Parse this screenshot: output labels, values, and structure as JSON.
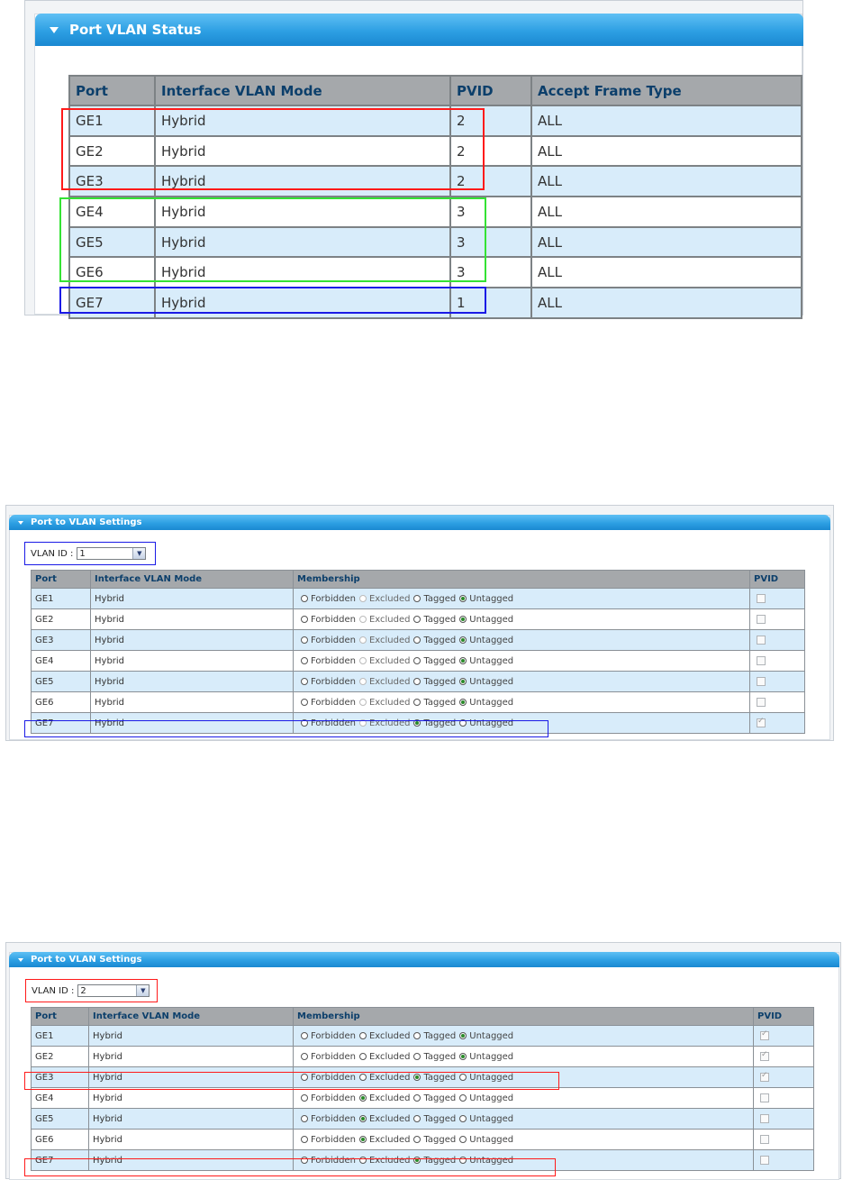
{
  "status_panel": {
    "title": "Port VLAN Status",
    "columns": [
      "Port",
      "Interface VLAN Mode",
      "PVID",
      "Accept Frame Type"
    ],
    "rows": [
      {
        "port": "GE1",
        "mode": "Hybrid",
        "pvid": "2",
        "accept": "ALL"
      },
      {
        "port": "GE2",
        "mode": "Hybrid",
        "pvid": "2",
        "accept": "ALL"
      },
      {
        "port": "GE3",
        "mode": "Hybrid",
        "pvid": "2",
        "accept": "ALL"
      },
      {
        "port": "GE4",
        "mode": "Hybrid",
        "pvid": "3",
        "accept": "ALL"
      },
      {
        "port": "GE5",
        "mode": "Hybrid",
        "pvid": "3",
        "accept": "ALL"
      },
      {
        "port": "GE6",
        "mode": "Hybrid",
        "pvid": "3",
        "accept": "ALL"
      },
      {
        "port": "GE7",
        "mode": "Hybrid",
        "pvid": "1",
        "accept": "ALL"
      }
    ]
  },
  "membership_options": [
    "Forbidden",
    "Excluded",
    "Tagged",
    "Untagged"
  ],
  "settings_panel_1": {
    "title": "Port to VLAN Settings",
    "vlan_id_label": "VLAN ID :",
    "vlan_id_value": "1",
    "columns": [
      "Port",
      "Interface VLAN Mode",
      "Membership",
      "PVID"
    ],
    "rows": [
      {
        "port": "GE1",
        "mode": "Hybrid",
        "membership": "Untagged",
        "pvid_checked": false
      },
      {
        "port": "GE2",
        "mode": "Hybrid",
        "membership": "Untagged",
        "pvid_checked": false
      },
      {
        "port": "GE3",
        "mode": "Hybrid",
        "membership": "Untagged",
        "pvid_checked": false
      },
      {
        "port": "GE4",
        "mode": "Hybrid",
        "membership": "Untagged",
        "pvid_checked": false
      },
      {
        "port": "GE5",
        "mode": "Hybrid",
        "membership": "Untagged",
        "pvid_checked": false
      },
      {
        "port": "GE6",
        "mode": "Hybrid",
        "membership": "Untagged",
        "pvid_checked": false
      },
      {
        "port": "GE7",
        "mode": "Hybrid",
        "membership": "Tagged",
        "pvid_checked": true
      }
    ]
  },
  "settings_panel_2": {
    "title": "Port to VLAN Settings",
    "vlan_id_label": "VLAN ID :",
    "vlan_id_value": "2",
    "columns": [
      "Port",
      "Interface VLAN Mode",
      "Membership",
      "PVID"
    ],
    "rows": [
      {
        "port": "GE1",
        "mode": "Hybrid",
        "membership": "Untagged",
        "pvid_checked": true
      },
      {
        "port": "GE2",
        "mode": "Hybrid",
        "membership": "Untagged",
        "pvid_checked": true
      },
      {
        "port": "GE3",
        "mode": "Hybrid",
        "membership": "Tagged",
        "pvid_checked": true
      },
      {
        "port": "GE4",
        "mode": "Hybrid",
        "membership": "Excluded",
        "pvid_checked": false
      },
      {
        "port": "GE5",
        "mode": "Hybrid",
        "membership": "Excluded",
        "pvid_checked": false
      },
      {
        "port": "GE6",
        "mode": "Hybrid",
        "membership": "Excluded",
        "pvid_checked": false
      },
      {
        "port": "GE7",
        "mode": "Hybrid",
        "membership": "Tagged",
        "pvid_checked": false
      }
    ]
  },
  "colors": {
    "title_bar": "#2d9fe3",
    "header_bg": "#a5a8ab",
    "header_text": "#0c3f6b",
    "row_alt": "#d8ecfa",
    "highlight_red": "#ff1a1a",
    "highlight_green": "#34e234",
    "highlight_blue": "#1a1ae6"
  },
  "icons": {
    "collapse": "triangle-down-icon",
    "dropdown": "chevron-down-icon",
    "radio": "radio-icon",
    "checkbox": "checkbox-icon"
  }
}
